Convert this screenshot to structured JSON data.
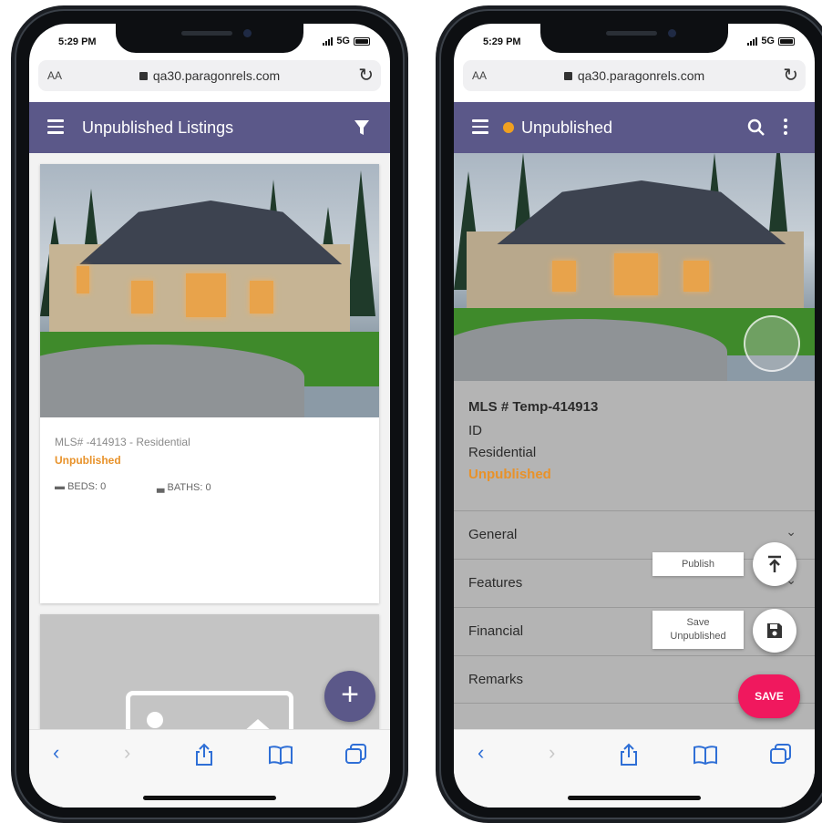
{
  "left": {
    "status": {
      "time": "5:29 PM",
      "network": "5G"
    },
    "browser": {
      "aa": "AA",
      "url": "qa30.paragonrels.com"
    },
    "appbar": {
      "title": "Unpublished Listings"
    },
    "listing": {
      "meta": "MLS# -414913 - Residential",
      "status": "Unpublished",
      "beds": "BEDS: 0",
      "baths": "BATHS: 0"
    },
    "fab_label": "+"
  },
  "right": {
    "status": {
      "time": "5:29 PM",
      "network": "5G"
    },
    "browser": {
      "aa": "AA",
      "url": "qa30.paragonrels.com"
    },
    "appbar": {
      "title": "Unpublished",
      "status_dot_color": "#f0a020"
    },
    "detail": {
      "mls": "MLS # Temp-414913",
      "id_label": "ID",
      "type": "Residential",
      "status": "Unpublished"
    },
    "sections": [
      "General",
      "Features",
      "Financial",
      "Remarks"
    ],
    "actions": {
      "publish": "Publish",
      "save_unpublished_line1": "Save",
      "save_unpublished_line2": "Unpublished",
      "save": "SAVE"
    }
  },
  "colors": {
    "appbar": "#5b5889",
    "accent_orange": "#e8922a",
    "save_button": "#f0185e",
    "ios_blue": "#2f6fd6"
  }
}
